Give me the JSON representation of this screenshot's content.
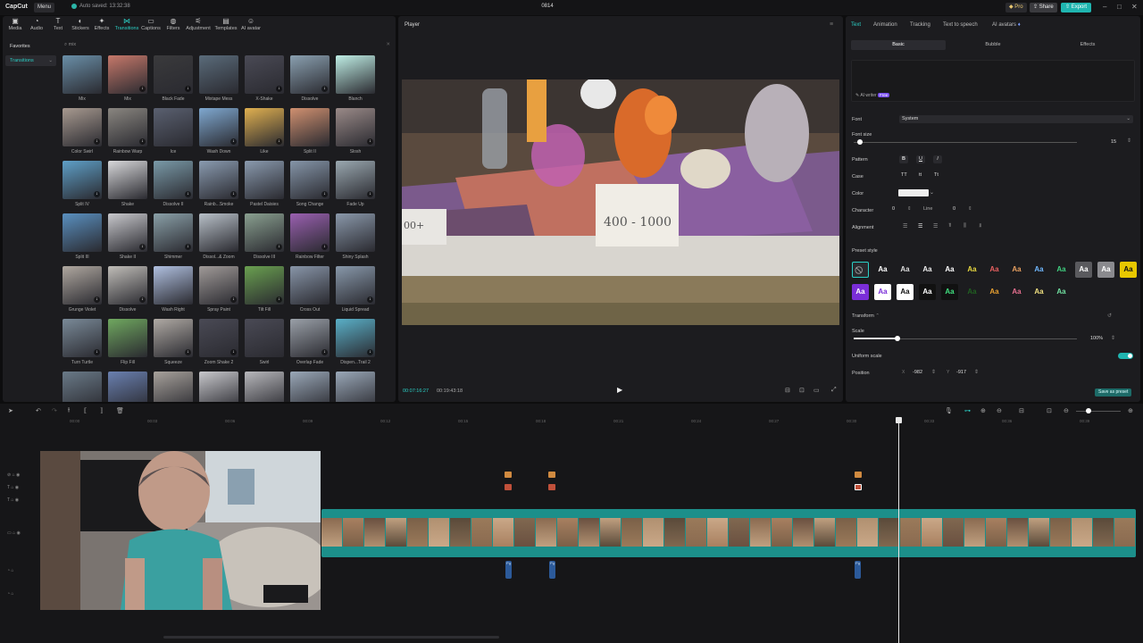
{
  "titlebar": {
    "logo": "CapCut",
    "menu": "Menu",
    "autosave": "Auto saved: 13:32:38",
    "project": "0814",
    "pro": "Pro",
    "share": "Share",
    "export": "Export"
  },
  "tools": [
    "Media",
    "Audio",
    "Text",
    "Stickers",
    "Effects",
    "Transitions",
    "Captions",
    "Filters",
    "Adjustment",
    "Templates",
    "AI avatar"
  ],
  "sidenav": {
    "favorites": "Favorites",
    "transitions": "Transitions"
  },
  "search": {
    "value": "mix"
  },
  "transitions": [
    {
      "label": "Mix",
      "color": "#6a8fa8"
    },
    {
      "label": "Mix",
      "color": "#c6786a"
    },
    {
      "label": "Black Fade",
      "color": "#3a3a3c"
    },
    {
      "label": "Mixtape Mess",
      "color": "#5a6b7a"
    },
    {
      "label": "X-Shake",
      "color": "#4a4a55"
    },
    {
      "label": "Dissolve",
      "color": "#8aa0b0"
    },
    {
      "label": "Blanch",
      "color": "#bfeee5"
    },
    {
      "label": "Color Swirl",
      "color": "#a89a90"
    },
    {
      "label": "Rainbow Warp",
      "color": "#8a8680"
    },
    {
      "label": "Ice",
      "color": "#5a6070"
    },
    {
      "label": "Wash Down",
      "color": "#7fa8d0"
    },
    {
      "label": "Like",
      "color": "#e0b050"
    },
    {
      "label": "Split II",
      "color": "#d09070"
    },
    {
      "label": "Slosh",
      "color": "#9a8a88"
    },
    {
      "label": "Split IV",
      "color": "#5fa0c8"
    },
    {
      "label": "Shake",
      "color": "#d8d8da"
    },
    {
      "label": "Dissolve II",
      "color": "#7a9aa8"
    },
    {
      "label": "Rainb...Smoke",
      "color": "#8a9bb0"
    },
    {
      "label": "Pastel Daisies",
      "color": "#8a9aae"
    },
    {
      "label": "Song Change",
      "color": "#8595a8"
    },
    {
      "label": "Fade Up",
      "color": "#9aa8b0"
    },
    {
      "label": "Split III",
      "color": "#5a90c0"
    },
    {
      "label": "Shake II",
      "color": "#c8c8cc"
    },
    {
      "label": "Shimmer",
      "color": "#8aa0a8"
    },
    {
      "label": "Dissol...& Zoom",
      "color": "#b8c0c8"
    },
    {
      "label": "Dissolve III",
      "color": "#8aa090"
    },
    {
      "label": "Rainbow Filter",
      "color": "#9a60b0"
    },
    {
      "label": "Shiny Splash",
      "color": "#8a98aa"
    },
    {
      "label": "Grunge Violet",
      "color": "#b0a8a0"
    },
    {
      "label": "Dissolve",
      "color": "#c0bdb8"
    },
    {
      "label": "Wash Right",
      "color": "#b0c0e0"
    },
    {
      "label": "Spray Paint",
      "color": "#a09a98"
    },
    {
      "label": "Tilt Fill",
      "color": "#6aa050"
    },
    {
      "label": "Cross Out",
      "color": "#8895a8"
    },
    {
      "label": "Liquid Spread",
      "color": "#8898aa"
    },
    {
      "label": "Turn Turtle",
      "color": "#7a8a98"
    },
    {
      "label": "Flip Fill",
      "color": "#70a860"
    },
    {
      "label": "Squeeze",
      "color": "#b0aaa4"
    },
    {
      "label": "Zoom Shake 2",
      "color": "#4a4a55"
    },
    {
      "label": "Swirl",
      "color": "#4a4a55"
    },
    {
      "label": "Overlap Fade",
      "color": "#9aa0a8"
    },
    {
      "label": "Dispen...Trail 2",
      "color": "#5ab0c8"
    },
    {
      "label": "",
      "color": "#6a7a88"
    },
    {
      "label": "",
      "color": "#6a80b0"
    },
    {
      "label": "",
      "color": "#a8a29c"
    },
    {
      "label": "",
      "color": "#c8c8cc"
    },
    {
      "label": "",
      "color": "#b8b8bc"
    },
    {
      "label": "",
      "color": "#9aa8b8"
    },
    {
      "label": "",
      "color": "#9aa8b8"
    }
  ],
  "player": {
    "title": "Player",
    "current": "00:07:16:27",
    "total": "00:19:43:18",
    "sign_a": "400 - 1000",
    "sign_b": "00+"
  },
  "right": {
    "tabs": [
      "Text",
      "Animation",
      "Tracking",
      "Text to speech",
      "AI avatars"
    ],
    "subtabs": [
      "Basic",
      "Bubble",
      "Effects"
    ],
    "ai_writer": "AI writer",
    "free": "Free",
    "font_label": "Font",
    "font_value": "System",
    "size_label": "Font size",
    "size_value": "15",
    "pattern_label": "Pattern",
    "pattern_btns": [
      "B",
      "U",
      "I"
    ],
    "case_label": "Case",
    "case_btns": [
      "TT",
      "tt",
      "Tt"
    ],
    "color_label": "Color",
    "character_label": "Character",
    "character_value": "0",
    "line_label": "Line",
    "line_value": "0",
    "alignment_label": "Alignment",
    "preset_label": "Preset style",
    "preset_text": "Aa",
    "transform_label": "Transform",
    "scale_label": "Scale",
    "scale_value": "100%",
    "uniform_label": "Uniform scale",
    "position_label": "Position",
    "pos_x_label": "X",
    "pos_x": "-982",
    "pos_y_label": "Y",
    "pos_y": "-917",
    "save_preset": "Save as preset"
  },
  "timeline": {
    "ruler": [
      "00:00",
      "00:03",
      "00:06",
      "00:09",
      "00:12",
      "00:15",
      "00:18",
      "00:21",
      "00:24",
      "00:27",
      "00:30",
      "00:33",
      "00:36",
      "00:39",
      "00:42"
    ],
    "audio_mark": "Pg"
  },
  "colors": {
    "accent": "#2bd0c6",
    "export": "#1fb5b0",
    "track": "#1c8f8a"
  }
}
